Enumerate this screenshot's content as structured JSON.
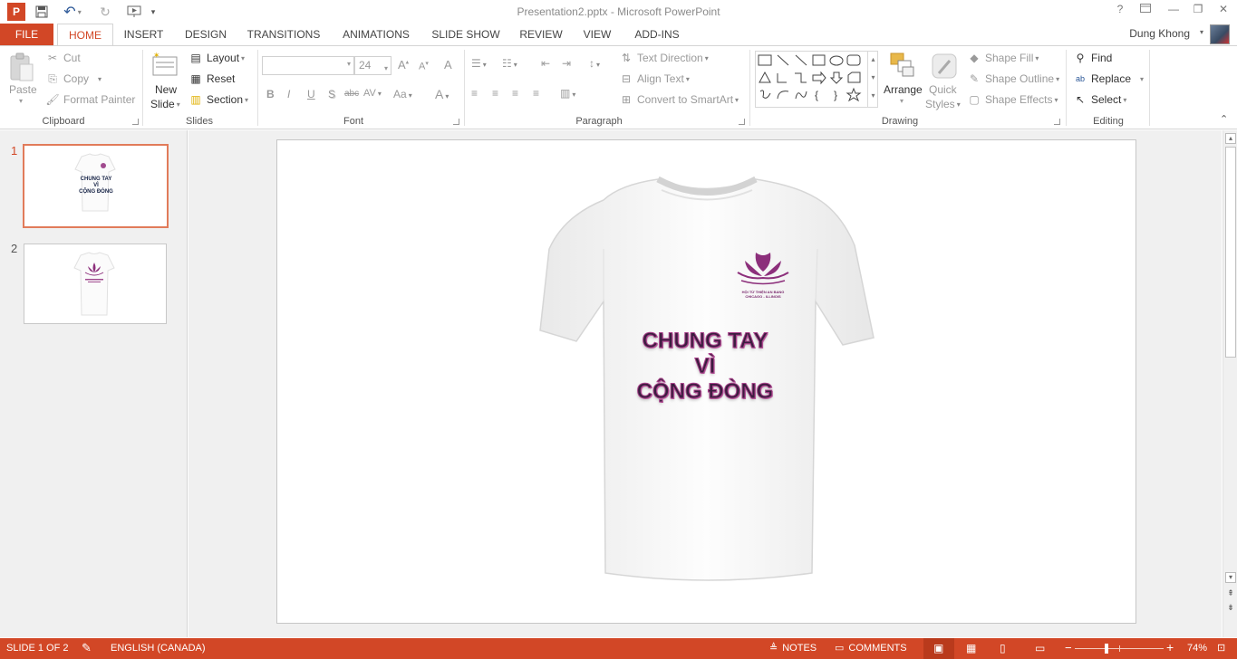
{
  "window": {
    "title": "Presentation2.pptx - Microsoft PowerPoint",
    "help": "?",
    "minimize": "—",
    "restore": "❐",
    "close": "✕"
  },
  "qat": {
    "app_icon": "P",
    "save": "💾",
    "undo": "↶",
    "redo": "↻",
    "present": "⊳",
    "customize": "▾"
  },
  "tabs": [
    "FILE",
    "HOME",
    "INSERT",
    "DESIGN",
    "TRANSITIONS",
    "ANIMATIONS",
    "SLIDE SHOW",
    "REVIEW",
    "VIEW",
    "ADD-INS"
  ],
  "user": {
    "name": "Dung Khong"
  },
  "ribbon": {
    "clipboard": {
      "label": "Clipboard",
      "paste": "Paste",
      "cut": "Cut",
      "copy": "Copy",
      "format_painter": "Format Painter"
    },
    "slides": {
      "label": "Slides",
      "new_slide_1": "New",
      "new_slide_2": "Slide",
      "layout": "Layout",
      "reset": "Reset",
      "section": "Section"
    },
    "font": {
      "label": "Font",
      "font_name": "",
      "font_size": "24",
      "bold": "B",
      "italic": "I",
      "underline": "U",
      "shadow": "S",
      "strike": "abc",
      "spacing": "AV",
      "case": "Aa",
      "color": "A",
      "grow": "A",
      "shrink": "A",
      "clear": "A"
    },
    "paragraph": {
      "label": "Paragraph",
      "text_direction": "Text Direction",
      "align_text": "Align Text",
      "convert_smartart": "Convert to SmartArt"
    },
    "drawing": {
      "label": "Drawing",
      "arrange": "Arrange",
      "quick_styles_1": "Quick",
      "quick_styles_2": "Styles",
      "shape_fill": "Shape Fill",
      "shape_outline": "Shape Outline",
      "shape_effects": "Shape Effects"
    },
    "editing": {
      "label": "Editing",
      "find": "Find",
      "replace": "Replace",
      "select": "Select"
    }
  },
  "slides_pane": {
    "thumbs": [
      {
        "num": "1",
        "lines": [
          "CHUNG TAY",
          "VÌ",
          "CỘNG ĐÒNG"
        ]
      },
      {
        "num": "2"
      }
    ]
  },
  "slide": {
    "headline": [
      "CHUNG TAY",
      "VÌ",
      "CỘNG ĐÒNG"
    ],
    "logo_line1": "HỘI TỪ THIỆN AN BANG",
    "logo_line2": "CHICAGO - ILLINOIS"
  },
  "status": {
    "slide_info": "SLIDE 1 OF 2",
    "language": "ENGLISH (CANADA)",
    "notes": "NOTES",
    "comments": "COMMENTS",
    "zoom": "74%",
    "zoom_value": 0.74
  },
  "colors": {
    "accent": "#d24726",
    "headline_text": "#3b1d3f",
    "headline_outline": "#a8418a",
    "logo": "#7a2a6e"
  }
}
